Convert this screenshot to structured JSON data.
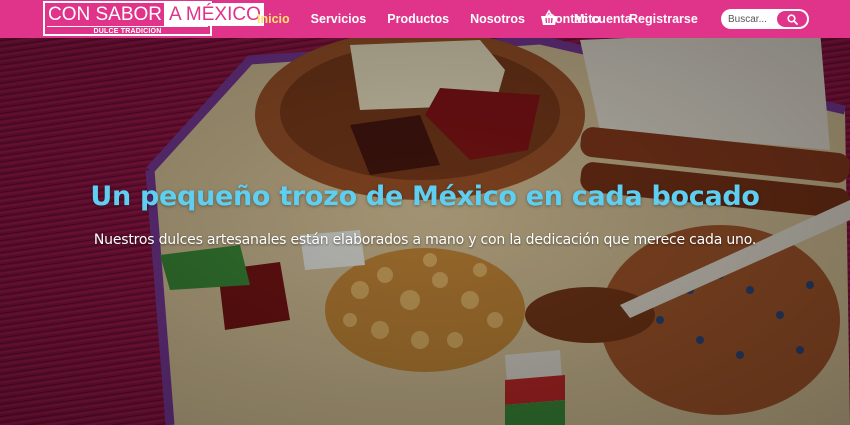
{
  "brand": {
    "name": "CON SABOR",
    "name_accent": "A MÉXICO",
    "tagline": "DULCE TRADICIÓN"
  },
  "nav": {
    "items": [
      {
        "label": "Inicio",
        "active": true
      },
      {
        "label": "Servicios",
        "active": false
      },
      {
        "label": "Productos",
        "active": false
      },
      {
        "label": "Nosotros",
        "active": false
      },
      {
        "label": "Contacto",
        "active": false
      }
    ],
    "cart_icon": "basket-icon",
    "account_label": "Mi cuenta",
    "register_label": "Registrarse"
  },
  "search": {
    "placeholder": "Buscar...",
    "button_icon": "search-icon"
  },
  "hero": {
    "headline": "Un pequeño trozo de México en cada bocado",
    "subline": "Nuestros dulces artesanales están elaborados a mano y con la dedicación que merece cada uno."
  },
  "colors": {
    "navbar": "#e0338a",
    "active_link": "#ffe36b",
    "headline": "#5ecff0",
    "text": "#ffffff"
  }
}
